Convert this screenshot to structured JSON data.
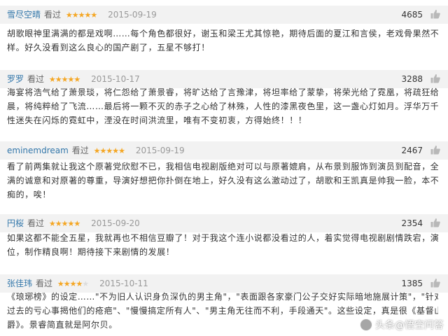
{
  "reviews": [
    {
      "user": "雪尽空晴",
      "watched": "看过",
      "rating": 5,
      "date": "2015-09-19",
      "votes": "4685",
      "lines": [
        "胡歌眼神里满满的都是戏啊……每个角色都很好，谢玉和梁王尤其惊艳，期待后面的夏江和言侯，老戏骨果然不一",
        "样。好久没看到这么良心的国产剧了，五星不够打！"
      ]
    },
    {
      "user": "罗罗",
      "watched": "看过",
      "rating": 5,
      "date": "2015-10-17",
      "votes": "3288",
      "lines": [
        "海宴将浩气给了萧景琰，将仁怨给了萧景睿，将旷达给了言豫津，将坦率给了蒙挚，将荣光给了霓凰，将疏狂给了蔺",
        "晨，将纯粹给了飞流……最后将一颗不灭的赤子之心给了林殊，人性的漆黑夜色里，这一盏心灯如月。浮华万千，人",
        "性迷失在闪烁的霓虹中，湮没在时间洪流里，唯有不变初衷，方得始终！！！"
      ]
    },
    {
      "user": "eminemdream",
      "watched": "看过",
      "rating": 5,
      "date": "2015-09-19",
      "votes": "2467",
      "lines": [
        "看了前两集就让我这个原著党欣慰不已，我相信电视剧版绝对可以与原著媲肩，从布景到服饰到演员到配音，全是满",
        "满的诚意和对原著的尊重，导演好想把你扑倒在地上，好久没有这么激动过了，胡歌和王凯真是帅我一脸，本不想花",
        "痴的，唉！"
      ]
    },
    {
      "user": "円桜",
      "watched": "看过",
      "rating": 5,
      "date": "2015-09-20",
      "votes": "2354",
      "lines": [
        "如果这都不能全五星，我就再也不相信豆瓣了！对于我这个连小说都没看过的人，着实觉得电视剧剧情跌宕，演员到",
        "位，制作精良啊！期待接下来剧情的发展！"
      ]
    },
    {
      "user": "张佳玮",
      "watched": "看过",
      "rating": 4,
      "date": "2015-10-11",
      "votes": "1385",
      "lines": [
        "《琅琊榜》的设定……\"不为旧人认识身负深仇的男主角\"，\"表面跟各家豪门公子交好实际暗地施展计策\"，\"针对仇人们",
        "过去的亏心事揭他们的疮疤\"、\"慢慢搞定所有人\"、\"男主角无往而不利，手段通天\"。这些设定，真是很《基督山伯",
        "爵》。景睿简直就是阿尔贝。"
      ]
    }
  ],
  "watermark": "头条@悟空问答",
  "colors": {
    "username": "#3377aa",
    "star": "#f4a623",
    "header_bg": "#f2f2f2"
  },
  "icons": {
    "thumb": "thumbs-up-icon"
  }
}
